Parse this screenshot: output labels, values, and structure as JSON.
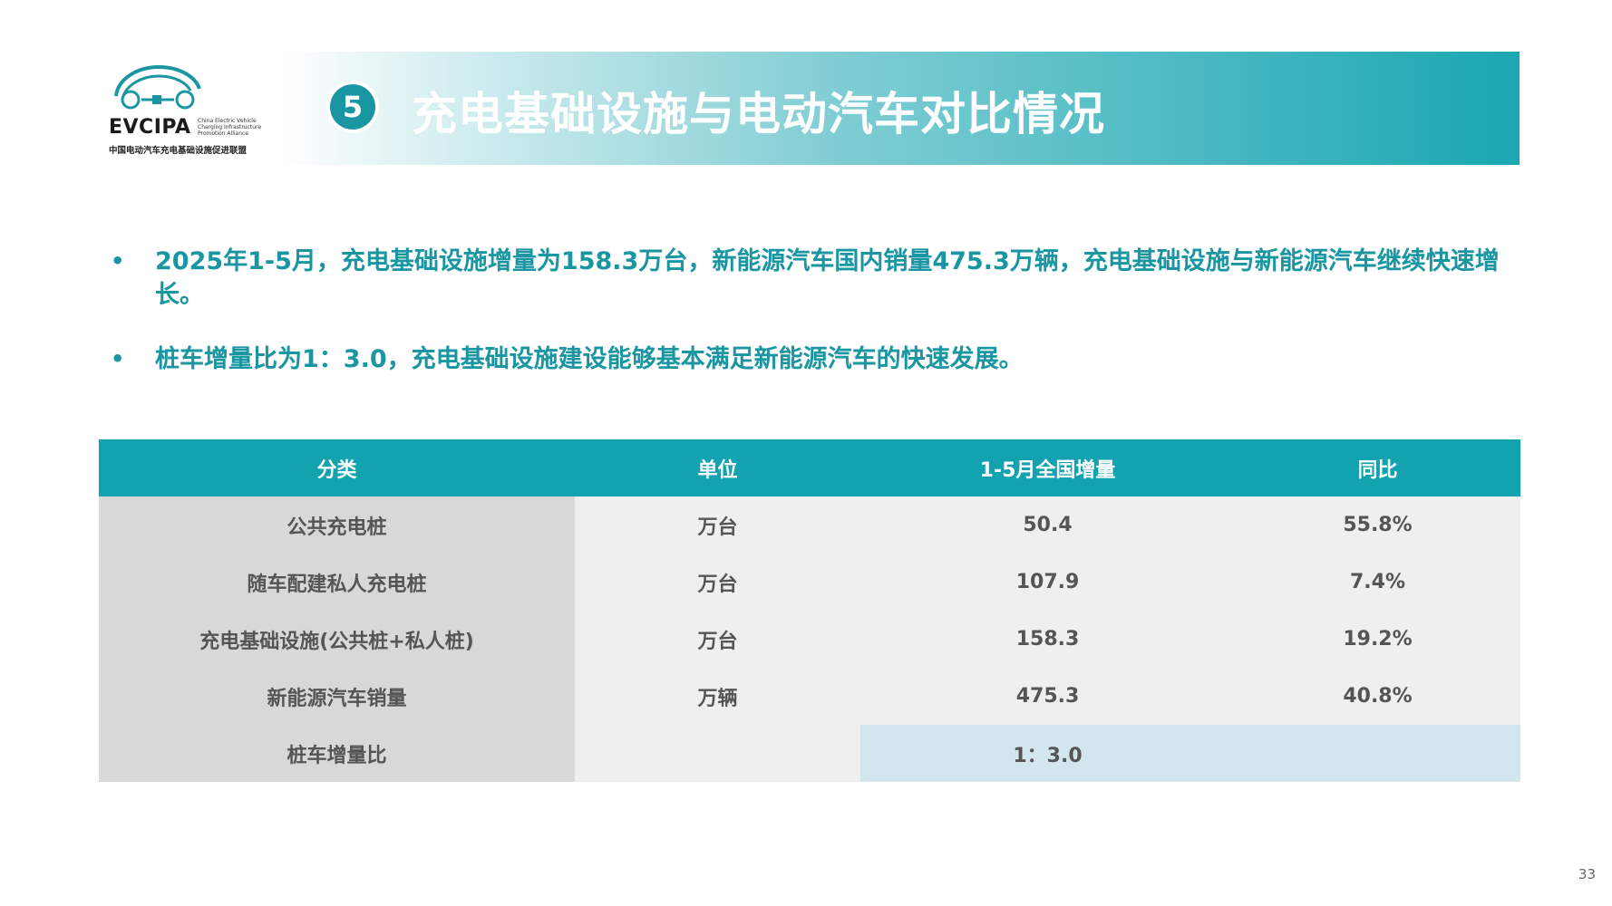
{
  "logo": {
    "name": "EVCIPA",
    "english_lines": [
      "China Electric Vehicle",
      "Charging Infrastructure",
      "Promotion Alliance"
    ],
    "chinese": "中国电动汽车充电基础设施促进联盟"
  },
  "header": {
    "section_number": "5",
    "title": "充电基础设施与电动汽车对比情况"
  },
  "bullets": [
    "2025年1-5月，充电基础设施增量为158.3万台，新能源汽车国内销量475.3万辆，充电基础设施与新能源汽车继续快速增长。",
    "桩车增量比为1：3.0，充电基础设施建设能够基本满足新能源汽车的快速发展。"
  ],
  "bullet_symbol": "•",
  "table": {
    "headers": [
      "分类",
      "单位",
      "1-5月全国增量",
      "同比"
    ],
    "rows": [
      [
        "公共充电桩",
        "万台",
        "50.4",
        "55.8%"
      ],
      [
        "随车配建私人充电桩",
        "万台",
        "107.9",
        "7.4%"
      ],
      [
        "充电基础设施(公共桩+私人桩)",
        "万台",
        "158.3",
        "19.2%"
      ],
      [
        "新能源汽车销量",
        "万辆",
        "475.3",
        "40.8%"
      ]
    ],
    "ratio_row": {
      "label": "桩车增量比",
      "value": "1：3.0"
    }
  },
  "page_number": "33",
  "colors": {
    "accent": "#1a96a2",
    "header_bg": "#13a2b0",
    "ratio_bg": "#d3e6ee"
  }
}
